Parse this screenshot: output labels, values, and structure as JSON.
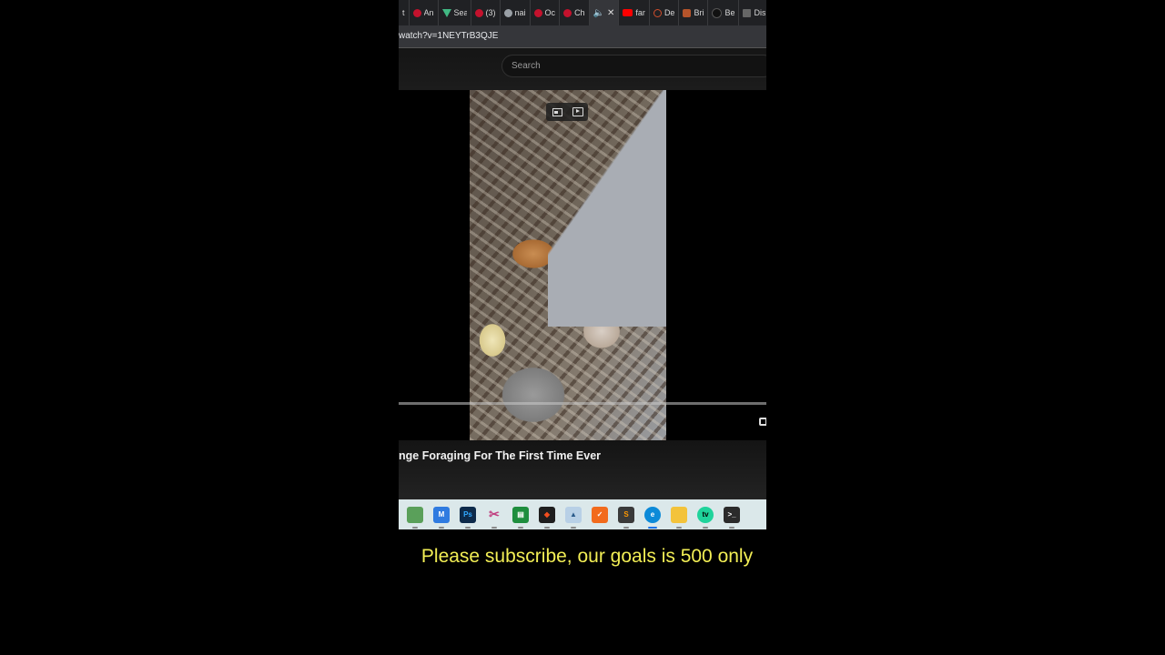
{
  "browser": {
    "tabs": [
      {
        "label": "t",
        "icon": "dot-icon"
      },
      {
        "label": "An",
        "icon": "youtube-icon"
      },
      {
        "label": "Sea",
        "icon": "vue-icon"
      },
      {
        "label": "(3)",
        "icon": "youtube-icon"
      },
      {
        "label": "nai",
        "icon": "chrome-icon"
      },
      {
        "label": "Oc",
        "icon": "youtube-icon"
      },
      {
        "label": "Ch",
        "icon": "youtube-icon"
      },
      {
        "label": "",
        "icon": "speaker-icon",
        "active": true
      },
      {
        "label": "far",
        "icon": "youtube-icon"
      },
      {
        "label": "De",
        "icon": "ring-icon"
      },
      {
        "label": "Bri",
        "icon": "brick-icon"
      },
      {
        "label": "Be",
        "icon": "dark-icon"
      },
      {
        "label": "Dis",
        "icon": "square-icon"
      }
    ],
    "url": "watch?v=1NEYTrB3QJE"
  },
  "youtube": {
    "search_placeholder": "Search",
    "video_title": "nge Foraging For The First Time Ever"
  },
  "taskbar": {
    "apps": [
      "maps",
      "monitor",
      "photoshop",
      "snip",
      "sheets",
      "figma",
      "photos",
      "todo",
      "sublime",
      "edge",
      "explorer",
      "tv",
      "terminal"
    ]
  },
  "caption": "Please subscribe, our goals is 500 only",
  "colors": {
    "caption": "#f2ee55",
    "taskbar": "#dbe8ea",
    "background": "#000000"
  }
}
